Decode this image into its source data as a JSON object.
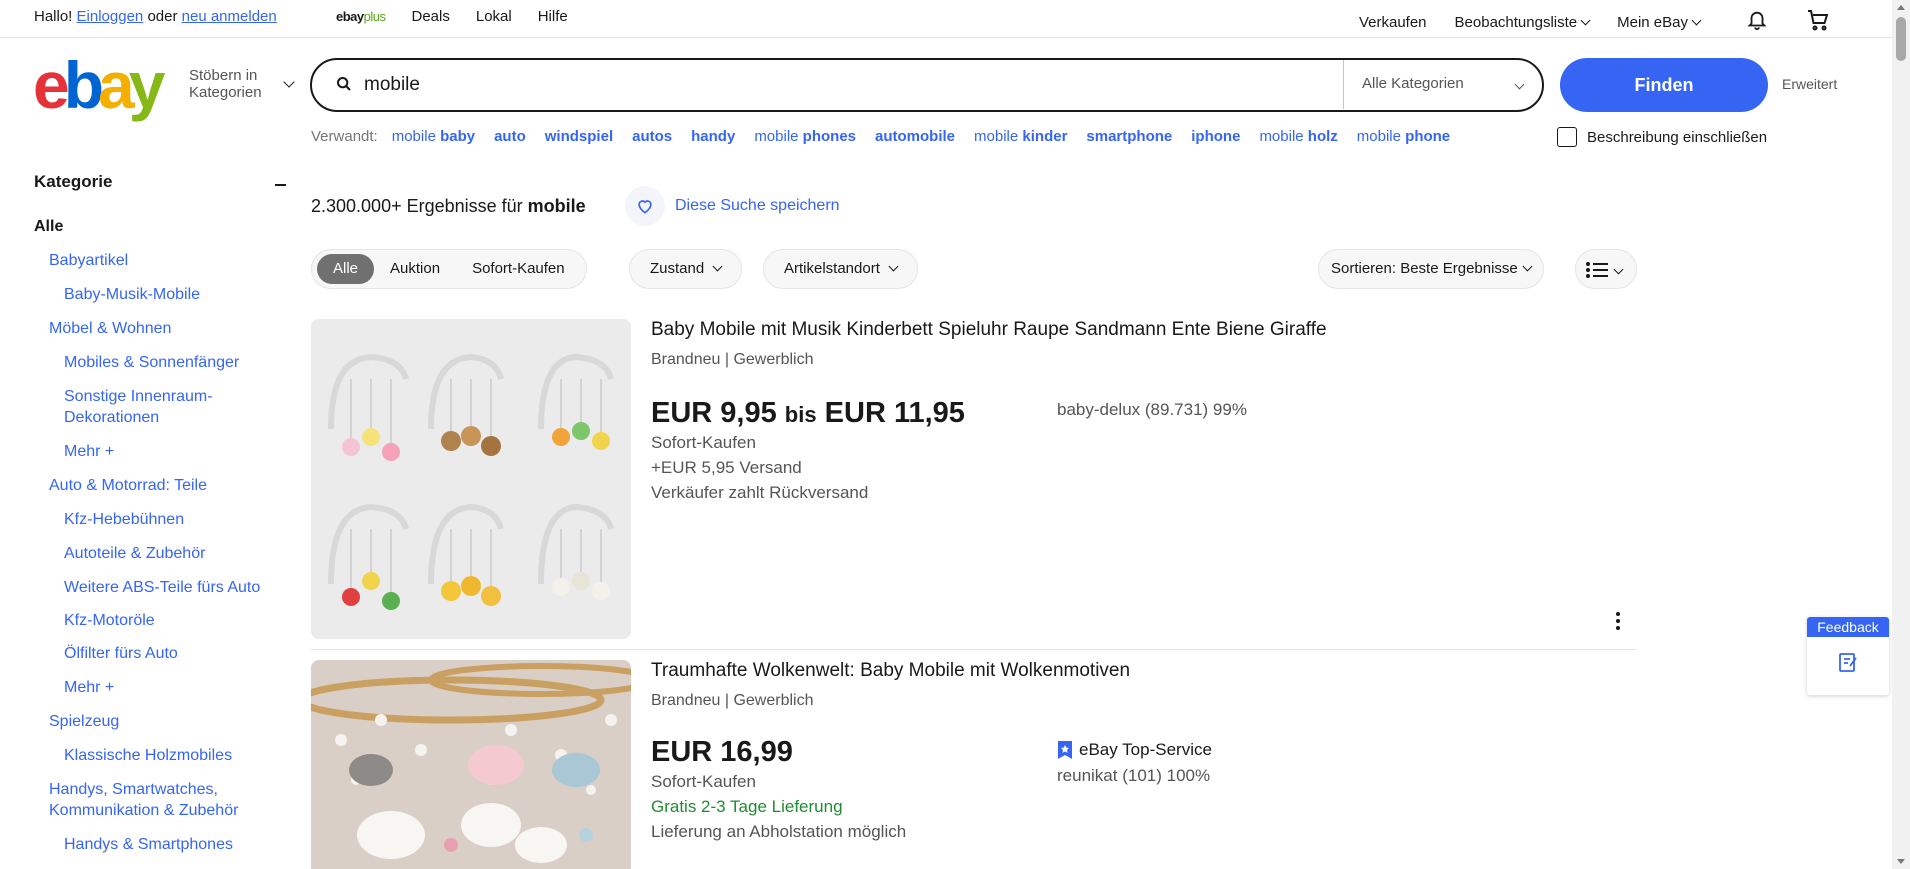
{
  "topbar": {
    "greeting": "Hallo!",
    "login": "Einloggen",
    "or": "oder",
    "register": "neu anmelden",
    "ebayplus_a": "ebay",
    "ebayplus_b": "plus",
    "nav": [
      "Deals",
      "Lokal",
      "Hilfe"
    ],
    "sell": "Verkaufen",
    "watchlist": "Beobachtungsliste",
    "my_ebay": "Mein eBay"
  },
  "header": {
    "logo": [
      "e",
      "b",
      "a",
      "y"
    ],
    "browse_line1": "Stöbern in",
    "browse_line2": "Kategorien"
  },
  "search": {
    "query": "mobile",
    "category": "Alle Kategorien",
    "find_label": "Finden",
    "advanced": "Erweitert"
  },
  "related": {
    "label": "Verwandt:",
    "items": [
      {
        "pre": "mobile ",
        "bold": "baby"
      },
      {
        "pre": "",
        "bold": "auto"
      },
      {
        "pre": "",
        "bold": "windspiel"
      },
      {
        "pre": "",
        "bold": "autos"
      },
      {
        "pre": "",
        "bold": "handy"
      },
      {
        "pre": "mobile ",
        "bold": "phones"
      },
      {
        "pre": "",
        "bold": "automobile"
      },
      {
        "pre": "mobile ",
        "bold": "kinder"
      },
      {
        "pre": "",
        "bold": "smartphone"
      },
      {
        "pre": "",
        "bold": "iphone"
      },
      {
        "pre": "mobile ",
        "bold": "holz"
      },
      {
        "pre": "mobile ",
        "bold": "phone"
      }
    ],
    "description_checkbox": "Beschreibung einschließen"
  },
  "sidebar": {
    "heading": "Kategorie",
    "items": [
      {
        "label": "Alle",
        "level": 0
      },
      {
        "label": "Babyartikel",
        "level": 1
      },
      {
        "label": "Baby-Musik-Mobile",
        "level": 2
      },
      {
        "label": "Möbel & Wohnen",
        "level": 1
      },
      {
        "label": "Mobiles & Sonnenfänger",
        "level": 2
      },
      {
        "label": "Sonstige Innenraum-",
        "label2": "Dekorationen",
        "level": 2
      },
      {
        "label": "Mehr  +",
        "level": 2
      },
      {
        "label": "Auto & Motorrad: Teile",
        "level": 1
      },
      {
        "label": "Kfz-Hebebühnen",
        "level": 2
      },
      {
        "label": "Autoteile & Zubehör",
        "level": 2
      },
      {
        "label": "Weitere ABS-Teile fürs Auto",
        "level": 2
      },
      {
        "label": "Kfz-Motoröle",
        "level": 2
      },
      {
        "label": "Ölfilter fürs Auto",
        "level": 2
      },
      {
        "label": "Mehr  +",
        "level": 2
      },
      {
        "label": "Spielzeug",
        "level": 1
      },
      {
        "label": "Klassische Holzmobiles",
        "level": 2
      },
      {
        "label": "Handys, Smartwatches,",
        "label2": "Kommunikation & Zubehör",
        "level": 1
      },
      {
        "label": "Handys & Smartphones",
        "level": 2
      }
    ]
  },
  "results": {
    "count_prefix": "2.300.000+ Ergebnisse für ",
    "count_query": "mobile",
    "save_search": "Diese Suche speichern"
  },
  "filters": {
    "segments": [
      "Alle",
      "Auktion",
      "Sofort-Kaufen"
    ],
    "condition": "Zustand",
    "location": "Artikelstandort",
    "sort": "Sortieren: Beste Ergebnisse"
  },
  "listings": [
    {
      "title": "Baby Mobile mit Musik Kinderbett Spieluhr Raupe Sandmann Ente Biene Giraffe",
      "condition": "Brandneu | Gewerblich",
      "price_from": "EUR 9,95",
      "price_sep": "bis",
      "price_to": "EUR 11,95",
      "buy_format": "Sofort-Kaufen",
      "shipping": "+EUR 5,95 Versand",
      "returns": "Verkäufer zahlt Rückversand",
      "seller": "baby-delux (89.731) 99%"
    },
    {
      "title": "Traumhafte Wolkenwelt: Baby Mobile mit Wolkenmotiven",
      "condition": "Brandneu | Gewerblich",
      "price": "EUR 16,99",
      "buy_format": "Sofort-Kaufen",
      "delivery": "Gratis 2-3 Tage Lieferung",
      "pickup": "Lieferung an Abholstation möglich",
      "top_service": "eBay Top-Service",
      "seller": "reunikat (101) 100%"
    }
  ],
  "feedback": {
    "label": "Feedback"
  },
  "colors": {
    "accent": "#3665f3",
    "green": "#218b34",
    "logo_e": "#e53238",
    "logo_b": "#0064d2",
    "logo_a": "#f5af02",
    "logo_y": "#86b817"
  }
}
